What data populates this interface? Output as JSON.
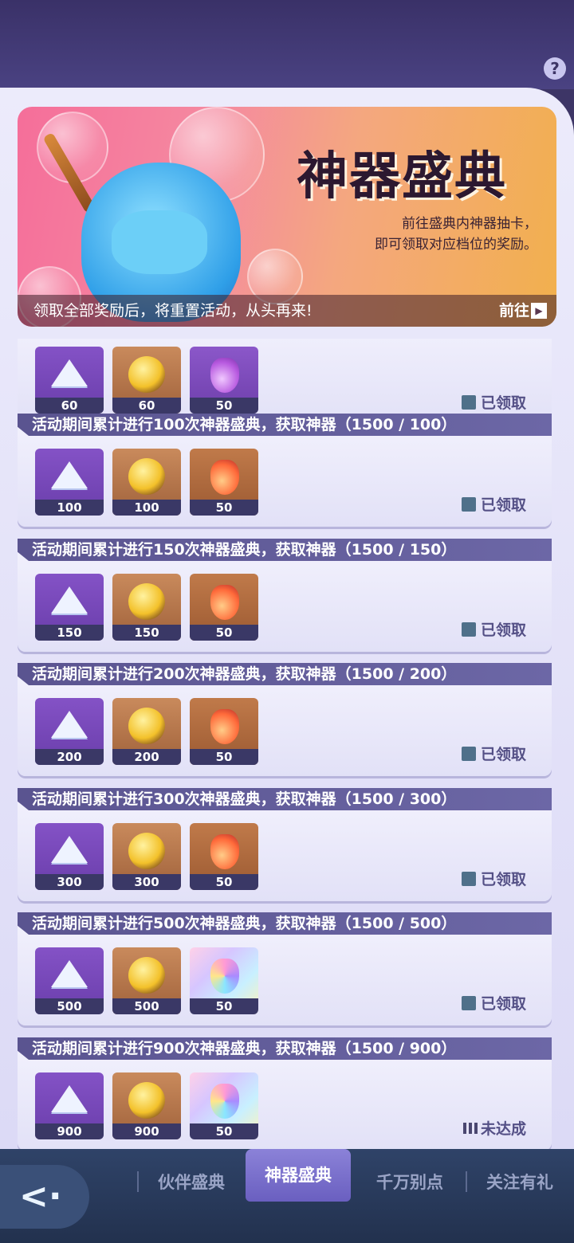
{
  "header": {
    "help_icon_label": "?"
  },
  "banner": {
    "title": "神器盛典",
    "desc_line1": "前往盛典内神器抽卡，",
    "desc_line2": "即可领取对应档位的奖励。",
    "bottom_msg": "领取全部奖励后，将重置活动，从头再来!",
    "go_label": "前往"
  },
  "rewards": [
    {
      "title": "",
      "items": [
        "60",
        "60",
        "50"
      ],
      "potion": "violet",
      "status": "已领取",
      "claimed": true
    },
    {
      "title": "活动期间累计进行100次神器盛典，获取神器（1500 / 100）",
      "items": [
        "100",
        "100",
        "50"
      ],
      "potion": "orange",
      "status": "已领取",
      "claimed": true
    },
    {
      "title": "活动期间累计进行150次神器盛典，获取神器（1500 / 150）",
      "items": [
        "150",
        "150",
        "50"
      ],
      "potion": "orange",
      "status": "已领取",
      "claimed": true
    },
    {
      "title": "活动期间累计进行200次神器盛典，获取神器（1500 / 200）",
      "items": [
        "200",
        "200",
        "50"
      ],
      "potion": "red",
      "status": "已领取",
      "claimed": true
    },
    {
      "title": "活动期间累计进行300次神器盛典，获取神器（1500 / 300）",
      "items": [
        "300",
        "300",
        "50"
      ],
      "potion": "red",
      "status": "已领取",
      "claimed": true
    },
    {
      "title": "活动期间累计进行500次神器盛典，获取神器（1500 / 500）",
      "items": [
        "500",
        "500",
        "50"
      ],
      "potion": "rainbow",
      "status": "已领取",
      "claimed": true
    },
    {
      "title": "活动期间累计进行900次神器盛典，获取神器（1500 / 900）",
      "items": [
        "900",
        "900",
        "50"
      ],
      "potion": "rainbow",
      "status": "未达成",
      "claimed": false
    }
  ],
  "tabs": [
    "伙伴盛典",
    "神器盛典",
    "千万别点",
    "关注有礼"
  ],
  "active_tab": "神器盛典"
}
